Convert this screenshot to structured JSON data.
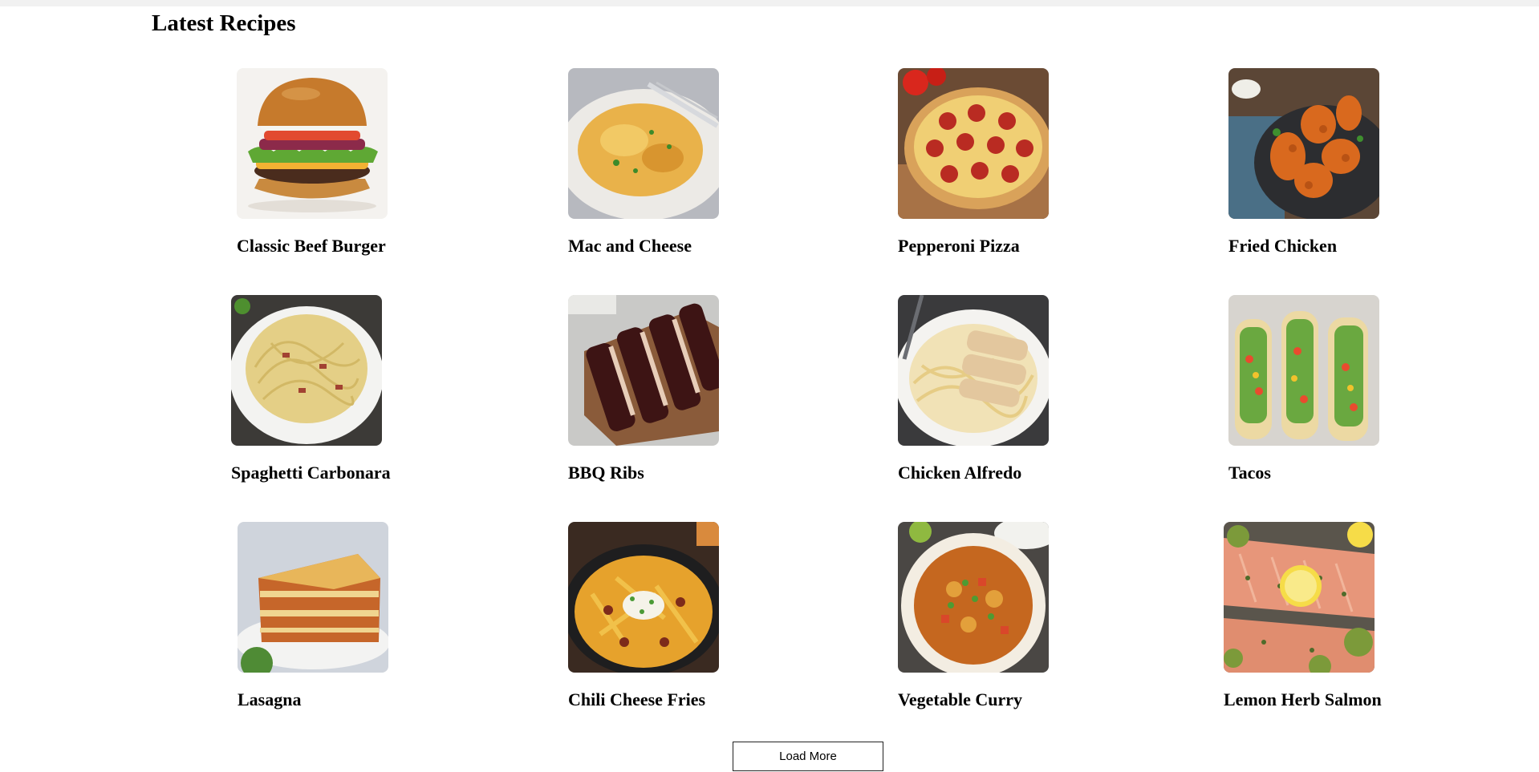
{
  "section": {
    "title": "Latest Recipes"
  },
  "recipes": [
    {
      "name": "Classic Beef Burger",
      "image": "burger-image"
    },
    {
      "name": "Mac and Cheese",
      "image": "mac-and-cheese-image"
    },
    {
      "name": "Pepperoni Pizza",
      "image": "pizza-image"
    },
    {
      "name": "Fried Chicken",
      "image": "fried-chicken-image"
    },
    {
      "name": "Spaghetti Carbonara",
      "image": "carbonara-image"
    },
    {
      "name": "BBQ Ribs",
      "image": "ribs-image"
    },
    {
      "name": "Chicken Alfredo",
      "image": "alfredo-image"
    },
    {
      "name": "Tacos",
      "image": "tacos-image"
    },
    {
      "name": "Lasagna",
      "image": "lasagna-image"
    },
    {
      "name": "Chili Cheese Fries",
      "image": "chili-fries-image"
    },
    {
      "name": "Vegetable Curry",
      "image": "curry-image"
    },
    {
      "name": "Lemon Herb Salmon",
      "image": "salmon-image"
    }
  ],
  "actions": {
    "load_more_label": "Load More"
  }
}
